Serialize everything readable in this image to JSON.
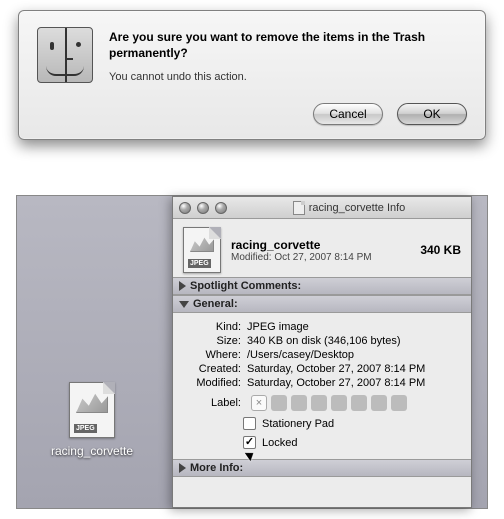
{
  "trash_dialog": {
    "title": "Are you sure you want to remove the items in the Trash permanently?",
    "subtitle": "You cannot undo this action.",
    "cancel_label": "Cancel",
    "ok_label": "OK"
  },
  "desktop_file": {
    "name": "racing_corvette",
    "badge": "JPEG"
  },
  "info_window": {
    "title": "racing_corvette Info",
    "header": {
      "name": "racing_corvette",
      "size": "340 KB",
      "modified_line": "Modified: Oct 27, 2007 8:14 PM"
    },
    "sections": {
      "spotlight_label": "Spotlight Comments:",
      "general_label": "General:",
      "moreinfo_label": "More Info:"
    },
    "general": {
      "kind_label": "Kind:",
      "kind_value": "JPEG image",
      "size_label": "Size:",
      "size_value": "340 KB on disk (346,106 bytes)",
      "where_label": "Where:",
      "where_value": "/Users/casey/Desktop",
      "created_label": "Created:",
      "created_value": "Saturday, October 27, 2007 8:14 PM",
      "modified_label": "Modified:",
      "modified_value": "Saturday, October 27, 2007 8:14 PM",
      "label_label": "Label:",
      "stationery_label": "Stationery Pad",
      "locked_label": "Locked",
      "stationery_checked": false,
      "locked_checked": true
    }
  }
}
